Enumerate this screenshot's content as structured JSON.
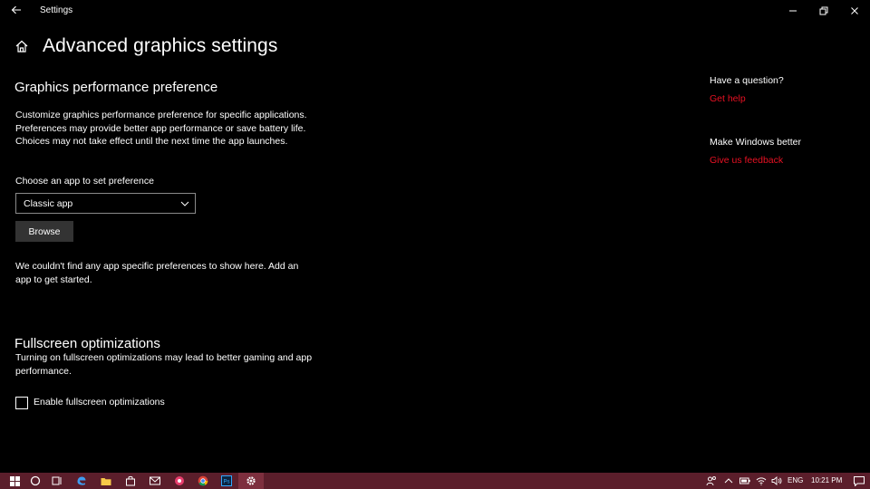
{
  "window": {
    "title": "Settings"
  },
  "header": {
    "title": "Advanced graphics settings"
  },
  "graphics": {
    "title": "Graphics performance preference",
    "description": "Customize graphics performance preference for specific applications. Preferences may provide better app performance or save battery life. Choices may not take effect until the next time the app launches.",
    "choose_label": "Choose an app to set preference",
    "dropdown_value": "Classic app",
    "browse_label": "Browse",
    "empty_message": "We couldn't find any app specific preferences to show here. Add an app to get started."
  },
  "fullscreen": {
    "title": "Fullscreen optimizations",
    "description": "Turning on fullscreen optimizations may lead to better gaming and app performance.",
    "checkbox_label": "Enable fullscreen optimizations",
    "checked": false
  },
  "sidebar": {
    "question_heading": "Have a question?",
    "get_help": "Get help",
    "improve_heading": "Make Windows better",
    "feedback": "Give us feedback"
  },
  "taskbar": {
    "language": "ENG",
    "time": "10:21 PM",
    "apps": [
      "start-icon",
      "cortana-icon",
      "task-view-icon",
      "edge-icon",
      "file-explorer-icon",
      "store-icon",
      "mail-icon",
      "app-icon",
      "chrome-icon",
      "photoshop-icon",
      "settings-icon"
    ]
  },
  "colors": {
    "accent_link": "#e81123",
    "taskbar": "#5b1e2b",
    "background": "#000000"
  }
}
